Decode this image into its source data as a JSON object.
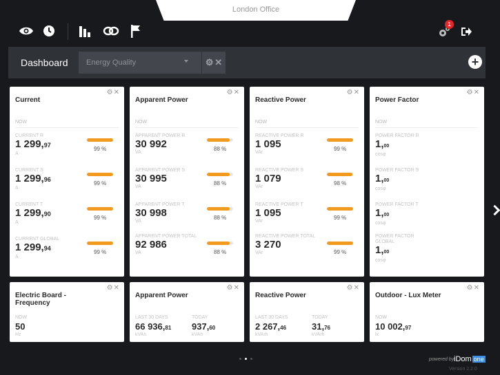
{
  "header": {
    "site_name": "London Office",
    "icons": [
      "eye-icon",
      "clock-icon",
      "bars-icon",
      "link-icon",
      "flag-icon",
      "gears-icon",
      "logout-icon"
    ],
    "notification_count": "1"
  },
  "toolbar": {
    "title": "Dashboard",
    "dashboard_select": "Energy Quality",
    "tools": [
      "gear-icon",
      "close-icon"
    ],
    "add_icon": "plus-icon"
  },
  "cards_row1": [
    {
      "title": "Current",
      "now": "NOW",
      "metrics": [
        {
          "label": "CURRENT R",
          "value": "1 299,",
          "decimals": "97",
          "unit": "A",
          "pct": "99 %",
          "fill": 99
        },
        {
          "label": "CURRENT S",
          "value": "1 299,",
          "decimals": "96",
          "unit": "A",
          "pct": "99 %",
          "fill": 99
        },
        {
          "label": "CURRENT T",
          "value": "1 299,",
          "decimals": "90",
          "unit": "A",
          "pct": "99 %",
          "fill": 99
        },
        {
          "label": "CURRENT GLOBAL",
          "value": "1 299,",
          "decimals": "94",
          "unit": "A",
          "pct": "99 %",
          "fill": 99
        }
      ]
    },
    {
      "title": "Apparent Power",
      "now": "NOW",
      "metrics": [
        {
          "label": "APPARENT POWER R",
          "value": "30 992",
          "decimals": "",
          "unit": "VA",
          "pct": "88 %",
          "fill": 88
        },
        {
          "label": "APPARENT POWER S",
          "value": "30 995",
          "decimals": "",
          "unit": "VA",
          "pct": "88 %",
          "fill": 88
        },
        {
          "label": "APPARENT POWER T",
          "value": "30 998",
          "decimals": "",
          "unit": "VA",
          "pct": "88 %",
          "fill": 88
        },
        {
          "label": "APPARENT POWER TOTAL",
          "value": "92 986",
          "decimals": "",
          "unit": "VA",
          "pct": "88 %",
          "fill": 88
        }
      ]
    },
    {
      "title": "Reactive Power",
      "now": "NOW",
      "metrics": [
        {
          "label": "REACTIVE POWER R",
          "value": "1 095",
          "decimals": "",
          "unit": "VAr",
          "pct": "99 %",
          "fill": 99
        },
        {
          "label": "REACTIVE POWER S",
          "value": "1 079",
          "decimals": "",
          "unit": "VAr",
          "pct": "98 %",
          "fill": 98
        },
        {
          "label": "REACTIVE POWER T",
          "value": "1 095",
          "decimals": "",
          "unit": "VAr",
          "pct": "99 %",
          "fill": 99
        },
        {
          "label": "REACTIVE POWER TOTAL",
          "value": "3 270",
          "decimals": "",
          "unit": "VAr",
          "pct": "99 %",
          "fill": 99
        }
      ]
    },
    {
      "title": "Power Factor",
      "now": "NOW",
      "metrics": [
        {
          "label": "POWER FACTOR R",
          "value": "1,",
          "decimals": "00",
          "unit": "cosφ"
        },
        {
          "label": "POWER FACTOR S",
          "value": "1,",
          "decimals": "00",
          "unit": "cosφ"
        },
        {
          "label": "POWER FACTOR T",
          "value": "1,",
          "decimals": "00",
          "unit": "cosφ"
        },
        {
          "label": "POWER FACTOR GLOBAL",
          "value": "1,",
          "decimals": "00",
          "unit": "cosφ"
        }
      ]
    }
  ],
  "cards_row2": [
    {
      "title": "Electric Board - Frequency",
      "now": "NOW",
      "value": "50",
      "decimals": "",
      "unit": "Hz"
    },
    {
      "title": "Apparent Power",
      "col1_label": "LAST 30 DAYS",
      "col1_value": "66 936,",
      "col1_dec": "81",
      "col1_unit": "kVAh",
      "col2_label": "TODAY",
      "col2_value": "937,",
      "col2_dec": "60",
      "col2_unit": "kVAh"
    },
    {
      "title": "Reactive Power",
      "col1_label": "LAST 30 DAYS",
      "col1_value": "2 267,",
      "col1_dec": "46",
      "col1_unit": "kVArh",
      "col2_label": "TODAY",
      "col2_value": "31,",
      "col2_dec": "76",
      "col2_unit": "kVArh"
    },
    {
      "title": "Outdoor - Lux Meter",
      "now": "NOW",
      "value": "10 002,",
      "decimals": "97",
      "unit": "lx"
    }
  ],
  "footer": {
    "powered_by": "powered by",
    "brand": "iDom",
    "brand_box": "one",
    "version": "Version 2.2.0"
  },
  "colors": {
    "accent": "#f29a1e",
    "background": "#17191c",
    "toolbar": "#2f3237",
    "badge": "#e5252a"
  }
}
